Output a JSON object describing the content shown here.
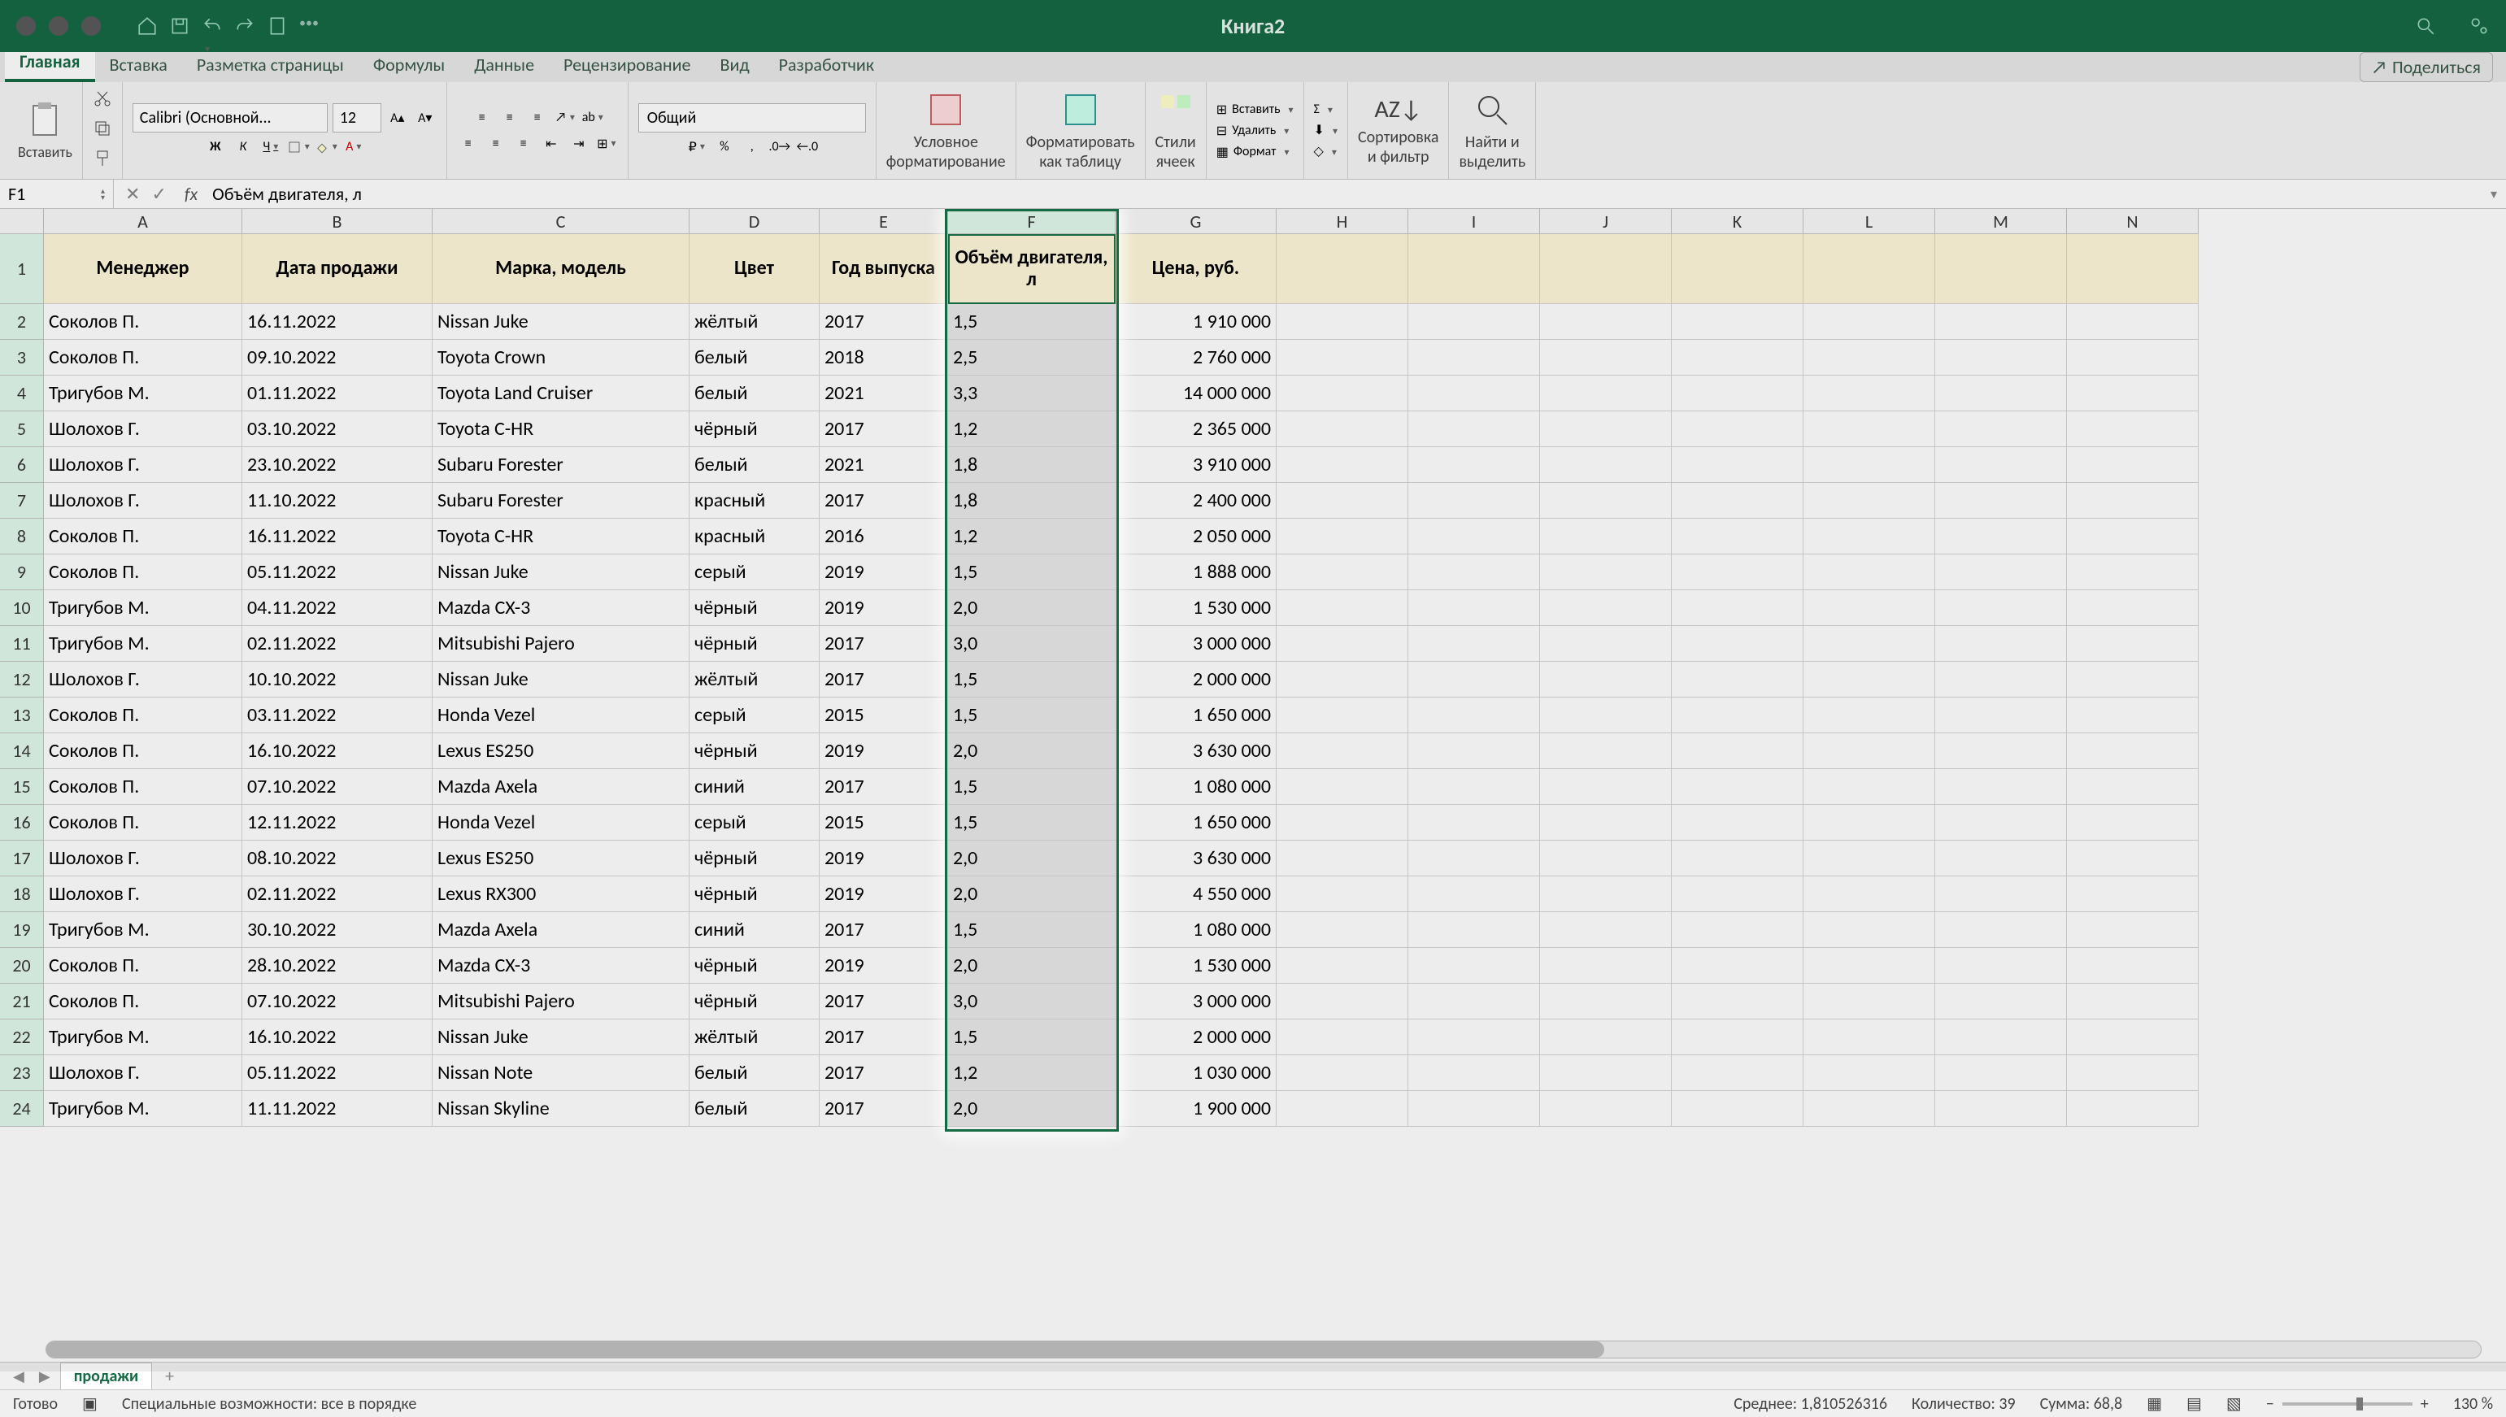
{
  "app": {
    "title": "Книга2"
  },
  "tabs": [
    "Главная",
    "Вставка",
    "Разметка страницы",
    "Формулы",
    "Данные",
    "Рецензирование",
    "Вид",
    "Разработчик"
  ],
  "share": "Поделиться",
  "font": {
    "family": "Calibri (Основной...",
    "size": "12"
  },
  "number_format": "Общий",
  "ribbon": {
    "paste": "Вставить",
    "conditional": "Условное\nформатирование",
    "formatTable": "Форматировать\nкак таблицу",
    "cellStyles": "Стили\nячеек",
    "insert": "Вставить",
    "delete": "Удалить",
    "formatBtn": "Формат",
    "sortFilter": "Сортировка\nи фильтр",
    "findSelect": "Найти и\nвыделить"
  },
  "name_box": "F1",
  "formula": "Объём двигателя, л",
  "columns": [
    "A",
    "B",
    "C",
    "D",
    "E",
    "F",
    "G",
    "H",
    "I",
    "J",
    "K",
    "L",
    "M",
    "N"
  ],
  "headers": [
    "Менеджер",
    "Дата продажи",
    "Марка, модель",
    "Цвет",
    "Год выпуска",
    "Объём двигателя, л",
    "Цена, руб."
  ],
  "rows": [
    [
      "Соколов П.",
      "16.11.2022",
      "Nissan Juke",
      "жёлтый",
      "2017",
      "1,5",
      "1 910 000"
    ],
    [
      "Соколов П.",
      "09.10.2022",
      "Toyota Crown",
      "белый",
      "2018",
      "2,5",
      "2 760 000"
    ],
    [
      "Тригубов М.",
      "01.11.2022",
      "Toyota Land Cruiser",
      "белый",
      "2021",
      "3,3",
      "14 000 000"
    ],
    [
      "Шолохов Г.",
      "03.10.2022",
      "Toyota C-HR",
      "чёрный",
      "2017",
      "1,2",
      "2 365 000"
    ],
    [
      "Шолохов Г.",
      "23.10.2022",
      "Subaru Forester",
      "белый",
      "2021",
      "1,8",
      "3 910 000"
    ],
    [
      "Шолохов Г.",
      "11.10.2022",
      "Subaru Forester",
      "красный",
      "2017",
      "1,8",
      "2 400 000"
    ],
    [
      "Соколов П.",
      "16.11.2022",
      "Toyota C-HR",
      "красный",
      "2016",
      "1,2",
      "2 050 000"
    ],
    [
      "Соколов П.",
      "05.11.2022",
      "Nissan Juke",
      "серый",
      "2019",
      "1,5",
      "1 888 000"
    ],
    [
      "Тригубов М.",
      "04.11.2022",
      "Mazda CX-3",
      "чёрный",
      "2019",
      "2,0",
      "1 530 000"
    ],
    [
      "Тригубов М.",
      "02.11.2022",
      "Mitsubishi Pajero",
      "чёрный",
      "2017",
      "3,0",
      "3 000 000"
    ],
    [
      "Шолохов Г.",
      "10.10.2022",
      "Nissan Juke",
      "жёлтый",
      "2017",
      "1,5",
      "2 000 000"
    ],
    [
      "Соколов П.",
      "03.11.2022",
      "Honda Vezel",
      "серый",
      "2015",
      "1,5",
      "1 650 000"
    ],
    [
      "Соколов П.",
      "16.10.2022",
      "Lexus ES250",
      "чёрный",
      "2019",
      "2,0",
      "3 630 000"
    ],
    [
      "Соколов П.",
      "07.10.2022",
      "Mazda Axela",
      "синий",
      "2017",
      "1,5",
      "1 080 000"
    ],
    [
      "Соколов П.",
      "12.11.2022",
      "Honda Vezel",
      "серый",
      "2015",
      "1,5",
      "1 650 000"
    ],
    [
      "Шолохов Г.",
      "08.10.2022",
      "Lexus ES250",
      "чёрный",
      "2019",
      "2,0",
      "3 630 000"
    ],
    [
      "Шолохов Г.",
      "02.11.2022",
      "Lexus RX300",
      "чёрный",
      "2019",
      "2,0",
      "4 550 000"
    ],
    [
      "Тригубов М.",
      "30.10.2022",
      "Mazda Axela",
      "синий",
      "2017",
      "1,5",
      "1 080 000"
    ],
    [
      "Соколов П.",
      "28.10.2022",
      "Mazda CX-3",
      "чёрный",
      "2019",
      "2,0",
      "1 530 000"
    ],
    [
      "Соколов П.",
      "07.10.2022",
      "Mitsubishi Pajero",
      "чёрный",
      "2017",
      "3,0",
      "3 000 000"
    ],
    [
      "Тригубов М.",
      "16.10.2022",
      "Nissan Juke",
      "жёлтый",
      "2017",
      "1,5",
      "2 000 000"
    ],
    [
      "Шолохов Г.",
      "05.11.2022",
      "Nissan Note",
      "белый",
      "2017",
      "1,2",
      "1 030 000"
    ],
    [
      "Тригубов М.",
      "11.11.2022",
      "Nissan Skyline",
      "белый",
      "2017",
      "2,0",
      "1 900 000"
    ]
  ],
  "sheet": "продажи",
  "status": {
    "ready": "Готово",
    "accessibility": "Специальные возможности: все в порядке",
    "avg": "Среднее: 1,810526316",
    "count": "Количество: 39",
    "sum": "Сумма: 68,8",
    "zoom": "130 %"
  }
}
